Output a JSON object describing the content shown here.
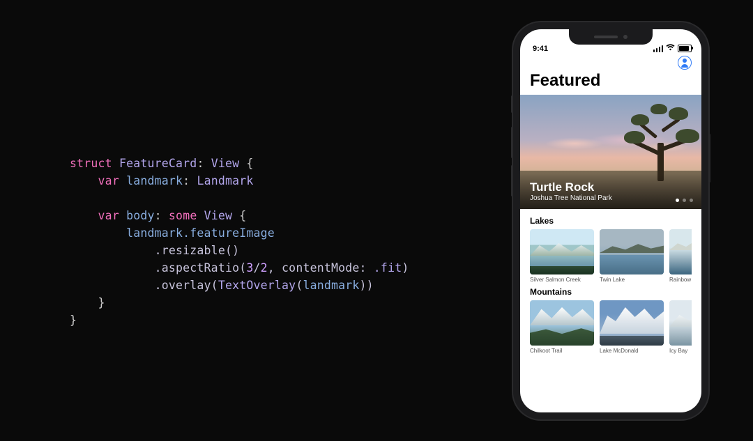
{
  "code": {
    "struct_kw": "struct",
    "struct_name": "FeatureCard",
    "view_protocol": "View",
    "open_brace": "{",
    "close_brace": "}",
    "var_kw": "var",
    "landmark_prop": "landmark",
    "landmark_type": "Landmark",
    "body_prop": "body",
    "some_kw": "some",
    "body_type": "View",
    "line_image": "landmark.featureImage",
    "line_resizable": ".resizable()",
    "line_aspect_prefix": ".aspectRatio(",
    "aspect_num1": "3",
    "aspect_slash": "/",
    "aspect_num2": "2",
    "aspect_mid": ", contentMode: ",
    "aspect_enum": ".fit",
    "aspect_close": ")",
    "line_overlay_prefix": ".overlay(",
    "overlay_type": "TextOverlay",
    "overlay_arg_open": "(",
    "overlay_arg": "landmark",
    "overlay_close": "))"
  },
  "status": {
    "time": "9:41"
  },
  "app": {
    "title": "Featured",
    "feature": {
      "title": "Turtle Rock",
      "subtitle": "Joshua Tree National Park"
    },
    "sections": [
      {
        "title": "Lakes",
        "items": [
          {
            "caption": "Silver Salmon Creek"
          },
          {
            "caption": "Twin Lake"
          },
          {
            "caption": "Rainbow La"
          }
        ]
      },
      {
        "title": "Mountains",
        "items": [
          {
            "caption": "Chilkoot Trail"
          },
          {
            "caption": "Lake McDonald"
          },
          {
            "caption": "Icy Bay"
          }
        ]
      }
    ]
  }
}
